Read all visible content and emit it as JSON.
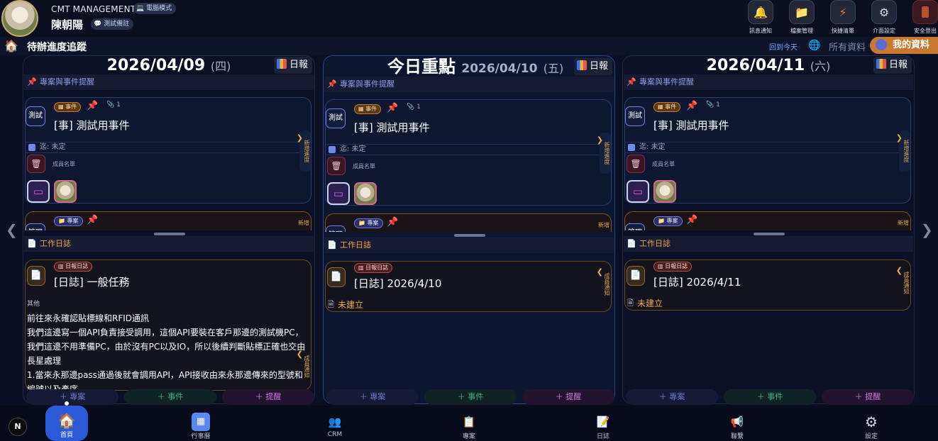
{
  "header": {
    "company": "CMT MANAGEMENT",
    "mode_pill": "電腦模式",
    "username": "陳朝陽",
    "note_pill": "測試備註",
    "buttons": [
      {
        "label": "訊息通知",
        "icon": "bell-icon"
      },
      {
        "label": "檔案管理",
        "icon": "folder-icon"
      },
      {
        "label": "快捷清單",
        "icon": "lightning-icon"
      },
      {
        "label": "介面設定",
        "icon": "gear-icon"
      },
      {
        "label": "安全登出",
        "icon": "door-icon"
      }
    ]
  },
  "subheader": {
    "title": "待辦進度追蹤",
    "back_today": "回到今天",
    "all_data": "所有資料",
    "my_data": "我的資料"
  },
  "columns": [
    {
      "date": "2026/04/09",
      "weekday": "(四)",
      "report_label": "日報",
      "section_events": "專案與事件提醒",
      "event": {
        "tag": "測試",
        "badge": "事件",
        "attachments": "1",
        "title": "[事] 測試用事件",
        "deadline": "迄: 未定",
        "members_label": "成員名單",
        "side_tab": "新增進度"
      },
      "project_peek": {
        "badge": "專案",
        "tag": "管理",
        "side_tab": "新增"
      },
      "section_log": "工作日誌",
      "log": {
        "badge": "日報日誌",
        "title": "[日誌] 一般任務",
        "side_tab": "成員通知",
        "category": "其他",
        "body": "前往來永確認貼標線和RFID通訊\n我們這邊寫一個API負責接受調用，這個API要裝在客戶那邊的測試機PC，我們這邊不用準備PC，由於沒有PC以及IO，所以後續判斷貼標正確也交由長星處理\n1.當來永那邊pass通過後就會調用API，API接收由來永那邊傳來的型號和編號以及產序..."
      },
      "not_built": null,
      "add": {
        "project": "專案",
        "event": "事件",
        "reminder": "提醒"
      }
    },
    {
      "today_label": "今日重點",
      "date": "2026/04/10",
      "weekday": "(五)",
      "report_label": "日報",
      "section_events": "專案與事件提醒",
      "event": {
        "tag": "測試",
        "badge": "事件",
        "attachments": "1",
        "title": "[事] 測試用事件",
        "deadline": "迄: 未定",
        "members_label": "成員名單",
        "side_tab": "新增進度"
      },
      "project_peek": {
        "badge": "專案",
        "tag": "管理",
        "side_tab": "新增"
      },
      "section_log": "工作日誌",
      "log": {
        "badge": "日報日誌",
        "title": "[日誌] 2026/4/10",
        "side_tab": "成員通知"
      },
      "not_built": "未建立",
      "add": {
        "project": "專案",
        "event": "事件",
        "reminder": "提醒"
      }
    },
    {
      "date": "2026/04/11",
      "weekday": "(六)",
      "report_label": "日報",
      "section_events": "專案與事件提醒",
      "event": {
        "tag": "測試",
        "badge": "事件",
        "attachments": "1",
        "title": "[事] 測試用事件",
        "deadline": "迄: 未定",
        "members_label": "成員名單",
        "side_tab": "新增進度"
      },
      "project_peek": {
        "badge": "專案",
        "tag": "管理",
        "side_tab": "新增"
      },
      "section_log": "工作日誌",
      "log": {
        "badge": "日報日誌",
        "title": "[日誌] 2026/4/11",
        "side_tab": "成員通知"
      },
      "not_built": "未建立",
      "add": {
        "project": "專案",
        "event": "事件",
        "reminder": "提醒"
      }
    }
  ],
  "bottom_nav": [
    {
      "label": "首頁",
      "icon": "home-icon",
      "active": true
    },
    {
      "label": "行事曆",
      "icon": "calendar-icon"
    },
    {
      "label": "CRM",
      "icon": "people-icon"
    },
    {
      "label": "專案",
      "icon": "clipboard-icon"
    },
    {
      "label": "日誌",
      "icon": "journal-icon"
    },
    {
      "label": "聯繫",
      "icon": "megaphone-icon"
    },
    {
      "label": "設定",
      "icon": "settings-icon"
    }
  ],
  "corner_badge": "N",
  "colors": {
    "accent_blue": "#2a5ad8",
    "accent_orange": "#c97830",
    "event_green": "#43b07f",
    "reminder_purple": "#c77ad8"
  }
}
